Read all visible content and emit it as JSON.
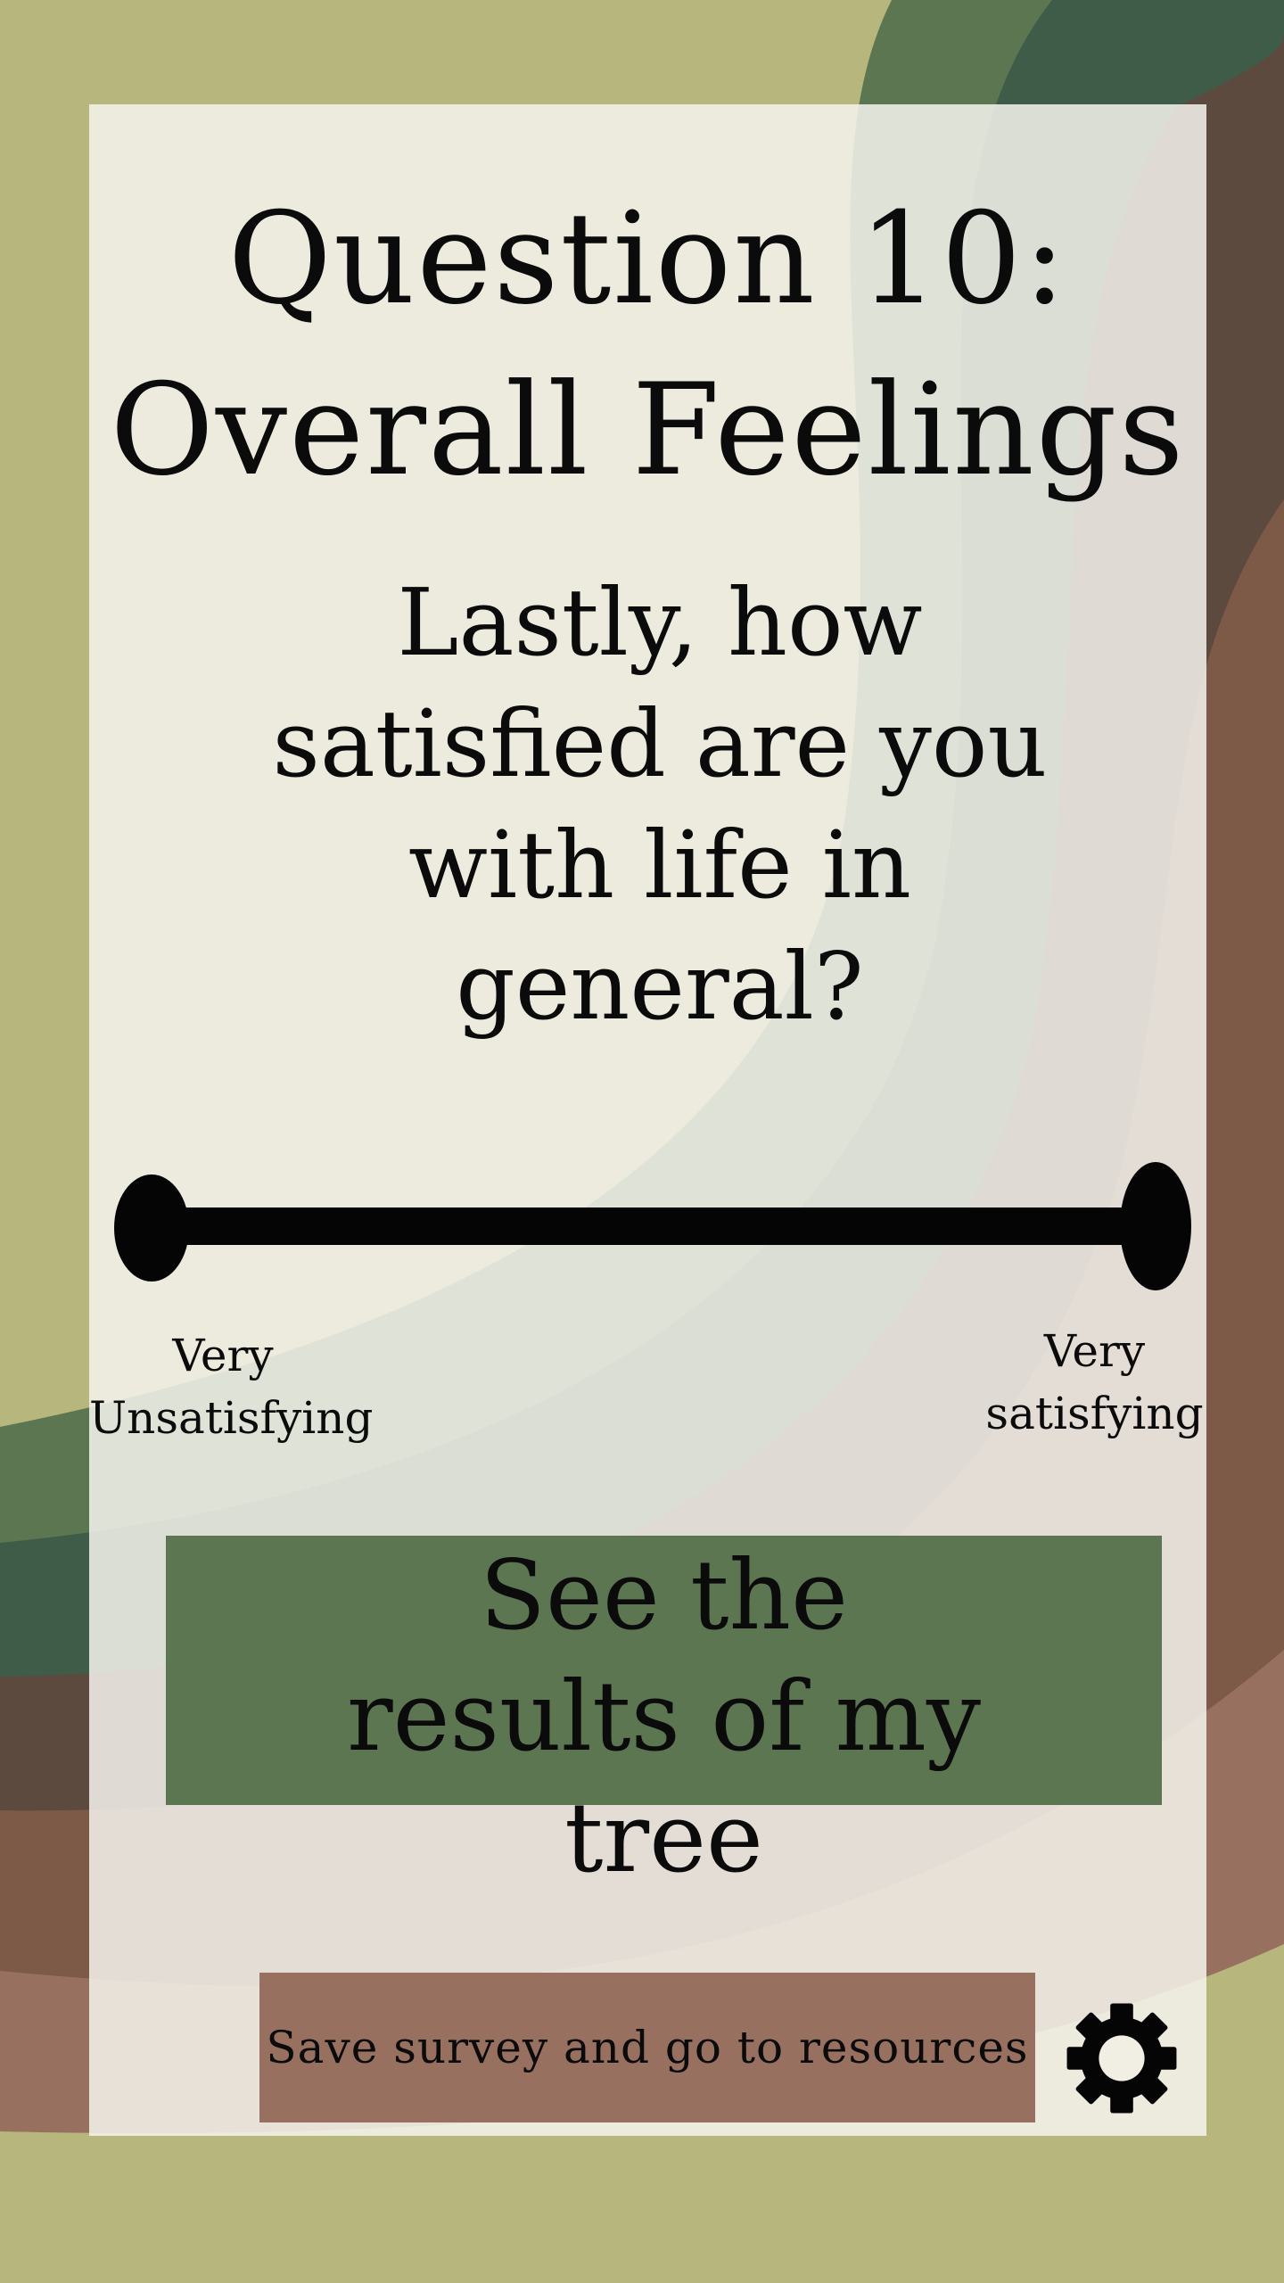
{
  "title": {
    "line1": "Question 10:",
    "line2": "Overall Feelings"
  },
  "question": "Lastly, how satisfied are you with life in general?",
  "slider": {
    "min_label_line1": "Very",
    "min_label_line2": "Unsatisfying",
    "max_label_line1": "Very",
    "max_label_line2": "satisfying"
  },
  "buttons": {
    "results": "See the results of my tree",
    "save": "Save survey and go to resources"
  },
  "icons": {
    "settings": "gear-icon"
  },
  "colors": {
    "background": "#b7b67d",
    "dark_green": "#3e5c47",
    "mid_green": "#5d7652",
    "dark_brown": "#5c4a3f",
    "brown": "#7d5947",
    "light_brown": "#98705f",
    "panel": "#f1efe4"
  }
}
